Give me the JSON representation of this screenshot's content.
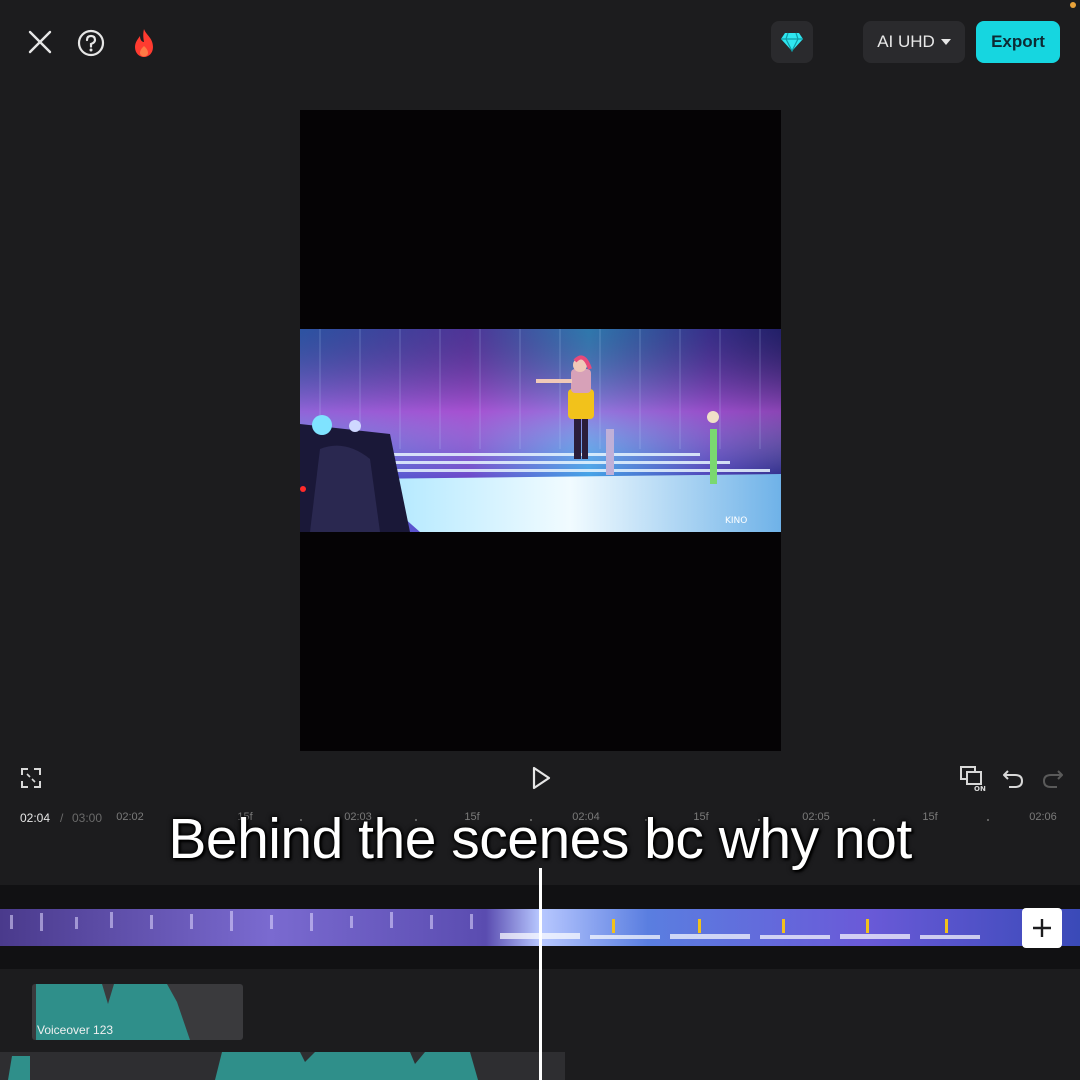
{
  "topbar": {
    "quality_label": "AI UHD",
    "export_label": "Export",
    "icons": [
      "close-icon",
      "help-icon",
      "fire-icon",
      "diamond-icon",
      "caret-down-icon"
    ]
  },
  "preview": {
    "watermark": "KINO"
  },
  "controls": {
    "icons": [
      "fullscreen-icon",
      "play-icon",
      "keyframe-icon",
      "undo-icon",
      "redo-icon"
    ],
    "keyframe_badge": "ON"
  },
  "timeline": {
    "current_time": "02:04",
    "separator": "/",
    "total_time": "03:00",
    "ruler_labels": [
      "02:02",
      "15f",
      "02:03",
      "15f",
      "02:04",
      "15f",
      "02:05",
      "15f",
      "02:06"
    ]
  },
  "caption": "Behind the scenes bc why not",
  "tracks": {
    "audio_label": "Voiceover 123",
    "add_icon": "plus-icon"
  },
  "colors": {
    "accent": "#16d6e0",
    "background": "#1c1c1e",
    "audio_wave": "#2f8f8a"
  }
}
